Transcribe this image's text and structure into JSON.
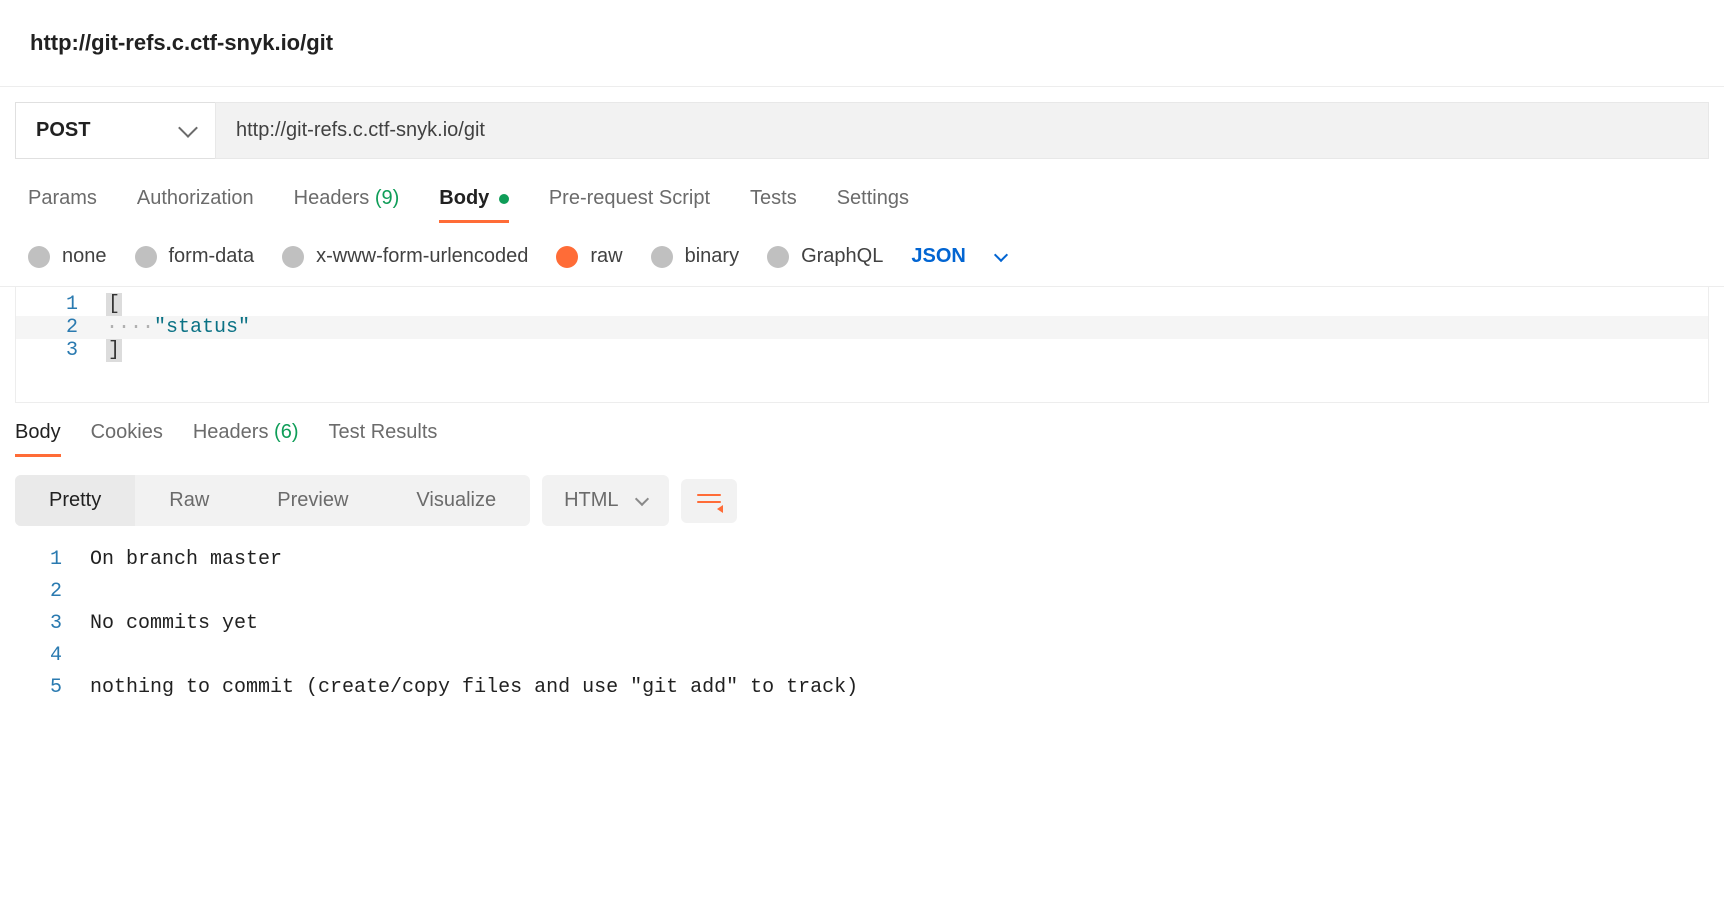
{
  "title": "http://git-refs.c.ctf-snyk.io/git",
  "request": {
    "method": "POST",
    "url": "http://git-refs.c.ctf-snyk.io/git"
  },
  "tabs": {
    "params": "Params",
    "auth": "Authorization",
    "headers_label": "Headers",
    "headers_count": "(9)",
    "body": "Body",
    "prerequest": "Pre-request Script",
    "tests": "Tests",
    "settings": "Settings"
  },
  "body_types": {
    "none": "none",
    "form_data": "form-data",
    "urlencoded": "x-www-form-urlencoded",
    "raw": "raw",
    "binary": "binary",
    "graphql": "GraphQL",
    "format": "JSON"
  },
  "editor": {
    "lines": {
      "l1_no": "1",
      "l1_bracket": "[",
      "l2_no": "2",
      "l2_dots": "····",
      "l2_str": "\"status\"",
      "l3_no": "3",
      "l3_bracket": "]"
    }
  },
  "response_tabs": {
    "body": "Body",
    "cookies": "Cookies",
    "headers_label": "Headers",
    "headers_count": "(6)",
    "test_results": "Test Results"
  },
  "response_toolbar": {
    "pretty": "Pretty",
    "raw": "Raw",
    "preview": "Preview",
    "visualize": "Visualize",
    "lang": "HTML"
  },
  "response_body": {
    "l1_no": "1",
    "l1": "On branch master",
    "l2_no": "2",
    "l2": "",
    "l3_no": "3",
    "l3": "No commits yet",
    "l4_no": "4",
    "l4": "",
    "l5_no": "5",
    "l5": "nothing to commit (create/copy files and use \"git add\" to track)"
  }
}
